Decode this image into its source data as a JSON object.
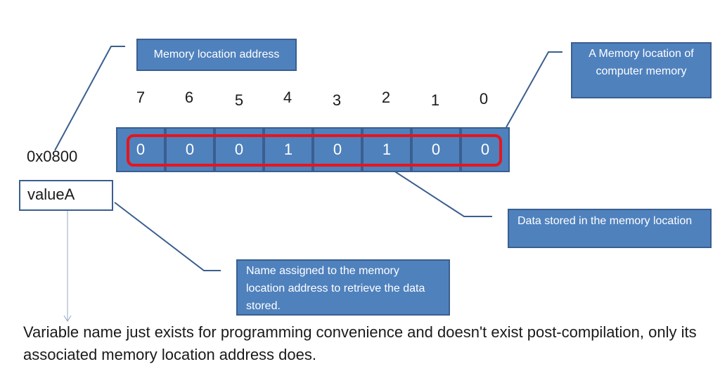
{
  "callouts": {
    "memory_location_address": "Memory location address",
    "memory_location": "A Memory location of computer memory",
    "data_stored": "Data stored in the memory location",
    "name_assigned": "Name assigned to the memory location address to retrieve the data stored."
  },
  "register": {
    "bit_numbers": [
      "7",
      "6",
      "5",
      "4",
      "3",
      "2",
      "1",
      "0"
    ],
    "bit_values": [
      "0",
      "0",
      "0",
      "1",
      "0",
      "1",
      "0",
      "0"
    ],
    "cell_color": "#4f81bd",
    "highlight_color": "#e8141c"
  },
  "address_label": "0x0800",
  "variable_name": "valueA",
  "caption": "Variable name just exists for programming convenience and doesn't exist post-compilation, only its associated memory location address does."
}
